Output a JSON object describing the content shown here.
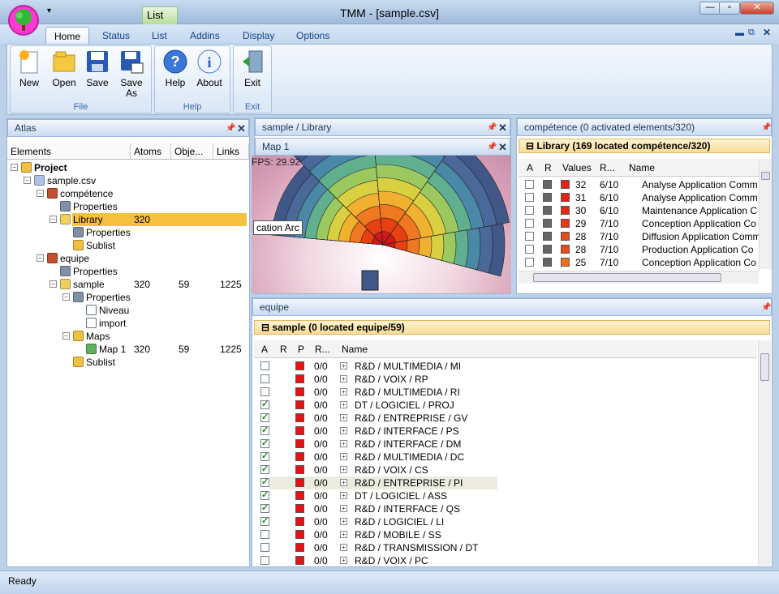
{
  "window": {
    "title": "TMM - [sample.csv]",
    "context_tab": "List"
  },
  "ribbon": {
    "tabs": [
      "Home",
      "Status",
      "List",
      "Addins",
      "Display",
      "Options"
    ],
    "groups": {
      "file": "File",
      "help": "Help",
      "exit": "Exit"
    },
    "buttons": {
      "new": "New",
      "open": "Open",
      "save": "Save",
      "save_as_1": "Save",
      "save_as_2": "As",
      "help": "Help",
      "about": "About",
      "exit": "Exit"
    }
  },
  "atlas": {
    "title": "Atlas",
    "columns": [
      "Elements",
      "Atoms",
      "Obje...",
      "Links"
    ],
    "tree": [
      {
        "label": "Project",
        "atoms": "",
        "objects": "",
        "links": "",
        "bold": true
      },
      {
        "label": "sample.csv",
        "atoms": "",
        "objects": "",
        "links": ""
      },
      {
        "label": "compétence",
        "atoms": "",
        "objects": "",
        "links": ""
      },
      {
        "label": "Properties",
        "atoms": "",
        "objects": "",
        "links": ""
      },
      {
        "label": "Library",
        "atoms": "320",
        "objects": "",
        "links": "",
        "selected": true
      },
      {
        "label": "Properties",
        "atoms": "",
        "objects": "",
        "links": ""
      },
      {
        "label": "Sublist",
        "atoms": "",
        "objects": "",
        "links": ""
      },
      {
        "label": "equipe",
        "atoms": "",
        "objects": "",
        "links": ""
      },
      {
        "label": "Properties",
        "atoms": "",
        "objects": "",
        "links": ""
      },
      {
        "label": "sample",
        "atoms": "320",
        "objects": "59",
        "links": "1225"
      },
      {
        "label": "Properties",
        "atoms": "",
        "objects": "",
        "links": ""
      },
      {
        "label": "Niveau",
        "atoms": "",
        "objects": "",
        "links": ""
      },
      {
        "label": "import",
        "atoms": "",
        "objects": "",
        "links": ""
      },
      {
        "label": "Maps",
        "atoms": "",
        "objects": "",
        "links": ""
      },
      {
        "label": "Map 1",
        "atoms": "320",
        "objects": "59",
        "links": "1225"
      },
      {
        "label": "Sublist",
        "atoms": "",
        "objects": "",
        "links": ""
      }
    ]
  },
  "library_view": {
    "title": "sample / Library",
    "map_title": "Map 1",
    "fps": "FPS: 29.92",
    "tooltip": "cation Arc"
  },
  "competence": {
    "title": "compétence (0 activated elements/320)",
    "group": "Library (169 located compétence/320)",
    "columns": [
      "A",
      "R",
      "Values",
      "R...",
      "Name"
    ],
    "rows": [
      {
        "value": "32",
        "r": "6/10",
        "name": "Analyse Application Comm",
        "color": "#e82010"
      },
      {
        "value": "31",
        "r": "6/10",
        "name": "Analyse Application Comm",
        "color": "#e82010"
      },
      {
        "value": "30",
        "r": "6/10",
        "name": "Maintenance Application C",
        "color": "#e82810"
      },
      {
        "value": "29",
        "r": "7/10",
        "name": "Conception Application Co",
        "color": "#ea3812"
      },
      {
        "value": "28",
        "r": "7/10",
        "name": "Diffusion Application Comm",
        "color": "#ec4814"
      },
      {
        "value": "28",
        "r": "7/10",
        "name": "Production Application Co",
        "color": "#ec4814"
      },
      {
        "value": "25",
        "r": "7/10",
        "name": "Conception Application Co",
        "color": "#f07018"
      }
    ]
  },
  "equipe": {
    "title": "equipe",
    "group": "sample (0 located equipe/59)",
    "columns": [
      "A",
      "R",
      "P",
      "R...",
      "Name"
    ],
    "rows": [
      {
        "checked": false,
        "r": "0/0",
        "name": "R&D / MULTIMEDIA / MI"
      },
      {
        "checked": false,
        "r": "0/0",
        "name": "R&D / VOIX / RP"
      },
      {
        "checked": false,
        "r": "0/0",
        "name": "R&D / MULTIMEDIA / RI"
      },
      {
        "checked": true,
        "r": "0/0",
        "name": "DT / LOGICIEL / PROJ"
      },
      {
        "checked": true,
        "r": "0/0",
        "name": "R&D / ENTREPRISE / GV"
      },
      {
        "checked": true,
        "r": "0/0",
        "name": "R&D / INTERFACE / PS"
      },
      {
        "checked": true,
        "r": "0/0",
        "name": "R&D / INTERFACE / DM"
      },
      {
        "checked": true,
        "r": "0/0",
        "name": "R&D / MULTIMEDIA / DC"
      },
      {
        "checked": true,
        "r": "0/0",
        "name": "R&D / VOIX / CS"
      },
      {
        "checked": true,
        "r": "0/0",
        "name": "R&D / ENTREPRISE / PI",
        "highlight": true
      },
      {
        "checked": true,
        "r": "0/0",
        "name": "DT / LOGICIEL / ASS"
      },
      {
        "checked": true,
        "r": "0/0",
        "name": "R&D / INTERFACE / QS"
      },
      {
        "checked": true,
        "r": "0/0",
        "name": "R&D / LOGICIEL / LI"
      },
      {
        "checked": false,
        "r": "0/0",
        "name": "R&D / MOBILE / SS"
      },
      {
        "checked": false,
        "r": "0/0",
        "name": "R&D / TRANSMISSION / DT"
      },
      {
        "checked": false,
        "r": "0/0",
        "name": "R&D / VOIX / PC"
      }
    ]
  },
  "status": {
    "text": "Ready"
  },
  "colors": {
    "swatch_red": "#e81010",
    "selection": "#f6c040",
    "group_bar": "#f8dc98"
  }
}
